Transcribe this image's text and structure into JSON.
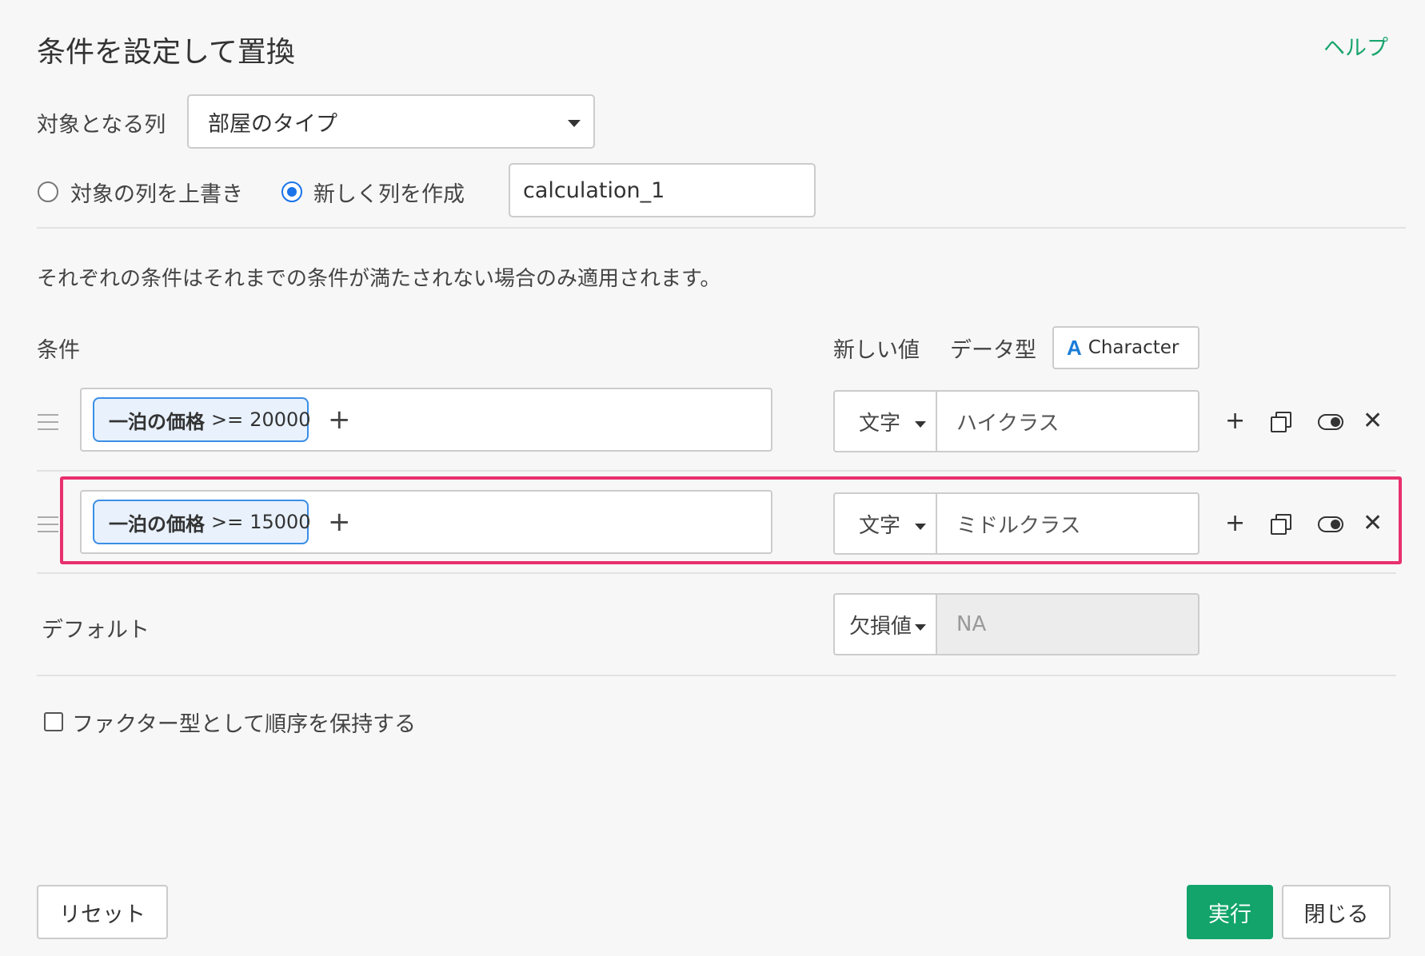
{
  "dialog": {
    "title": "条件を設定して置換",
    "help_label": "ヘルプ"
  },
  "target": {
    "label": "対象となる列",
    "selected": "部屋のタイプ"
  },
  "mode": {
    "overwrite_label": "対象の列を上書き",
    "new_column_label": "新しく列を作成",
    "new_column_checked": true,
    "new_column_name": "calculation_1"
  },
  "note": "それぞれの条件はそれまでの条件が満たされない場合のみ適用されます。",
  "headers": {
    "condition": "条件",
    "new_value": "新しい値",
    "data_type": "データ型",
    "type_value": "Character",
    "type_icon": "A"
  },
  "rules": [
    {
      "column": "一泊の価格",
      "operator": ">=",
      "value": "20000",
      "type": "文字",
      "new_value": "ハイクラス"
    },
    {
      "column": "一泊の価格",
      "operator": ">=",
      "value": "15000",
      "type": "文字",
      "new_value": "ミドルクラス",
      "highlighted": true
    }
  ],
  "default": {
    "label": "デフォルト",
    "type": "欠損値",
    "value": "NA"
  },
  "factor": {
    "label": "ファクター型として順序を保持する",
    "checked": false
  },
  "footer": {
    "reset": "リセット",
    "run": "実行",
    "close": "閉じる"
  },
  "icons": {
    "add": "plus-icon",
    "copy": "copy-icon",
    "toggle": "toggle-icon",
    "remove": "close-icon",
    "drag": "drag-handle-icon"
  },
  "colors": {
    "accent": "#12a46a",
    "help_link": "#1aa56e",
    "highlight": "#e8306e",
    "chip_border": "#3a8ee6"
  }
}
